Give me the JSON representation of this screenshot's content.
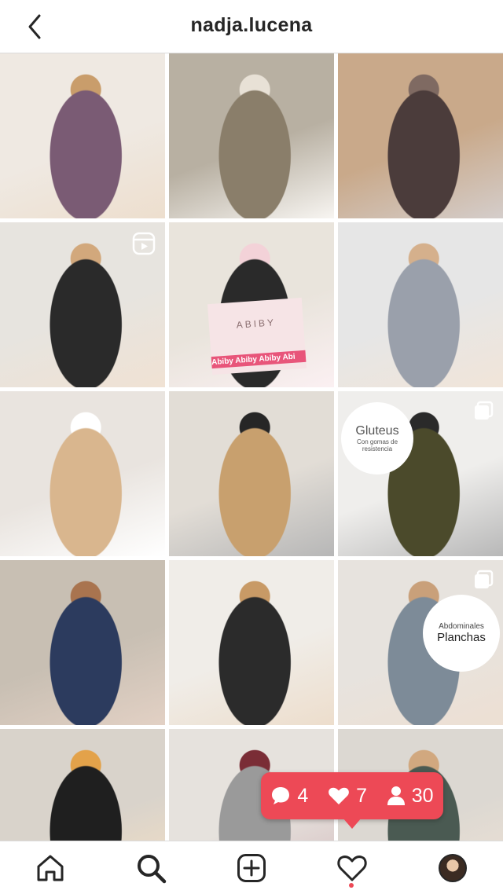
{
  "header": {
    "username": "nadja.lucena",
    "back_icon": "chevron-left-icon"
  },
  "grid": {
    "columns": 3,
    "posts": [
      {
        "id": "p1",
        "colors": [
          "#efe9e2",
          "#7a5b74",
          "#c99d6b"
        ],
        "badge": null
      },
      {
        "id": "p2",
        "colors": [
          "#b8b0a2",
          "#8a7e6a",
          "#e8e1d6"
        ],
        "badge": null
      },
      {
        "id": "p3",
        "colors": [
          "#c9a98a",
          "#4b3c3b",
          "#7f6a62"
        ],
        "badge": null
      },
      {
        "id": "p4",
        "colors": [
          "#e7e4df",
          "#2a2a2a",
          "#d2a87c"
        ],
        "badge": "reels-icon"
      },
      {
        "id": "p5",
        "colors": [
          "#e9e4dc",
          "#2a2a2a",
          "#f3d2d8"
        ],
        "badge": null
      },
      {
        "id": "p6",
        "colors": [
          "#e6e6e6",
          "#9aa0ab",
          "#d5b08c"
        ],
        "badge": null
      },
      {
        "id": "p7",
        "colors": [
          "#e9e4df",
          "#d9b68e",
          "#ffffff"
        ],
        "badge": null
      },
      {
        "id": "p8",
        "colors": [
          "#e2ddd6",
          "#c8a06e",
          "#262626"
        ],
        "badge": null
      },
      {
        "id": "p9",
        "colors": [
          "#efeeec",
          "#4b4a2b",
          "#2a2a2a"
        ],
        "badge": "carousel-icon"
      },
      {
        "id": "p10",
        "colors": [
          "#c8bfb3",
          "#2c3b5e",
          "#a9744f"
        ],
        "badge": null
      },
      {
        "id": "p11",
        "colors": [
          "#f0ede8",
          "#2b2b2b",
          "#c89a66"
        ],
        "badge": null
      },
      {
        "id": "p12",
        "colors": [
          "#e7e3de",
          "#7d8b98",
          "#c9a07a"
        ],
        "badge": "carousel-icon"
      },
      {
        "id": "p13",
        "colors": [
          "#d9d3cb",
          "#1f1f1f",
          "#e3a24a"
        ],
        "badge": null
      },
      {
        "id": "p14",
        "colors": [
          "#e6e2dd",
          "#9a9a9a",
          "#7a2d36"
        ],
        "badge": null
      },
      {
        "id": "p15",
        "colors": [
          "#dcd8d2",
          "#4a5a52",
          "#d1a87f"
        ],
        "badge": null
      }
    ],
    "overlays": {
      "abiby_box": "ABIBY",
      "abiby_tape": "Abiby  Abiby  Abiby  Abi",
      "gluteus_title": "Gluteus",
      "gluteus_sub1": "Con gomas de",
      "gluteus_sub2": "resistencia",
      "abs_line1": "Abdominales",
      "abs_line2": "Planchas"
    }
  },
  "notification": {
    "comments": "4",
    "likes": "7",
    "followers": "30",
    "color": "#ed4956"
  },
  "bottom_nav": {
    "items": [
      "home-icon",
      "search-icon",
      "new-post-icon",
      "activity-icon",
      "profile-avatar"
    ]
  }
}
